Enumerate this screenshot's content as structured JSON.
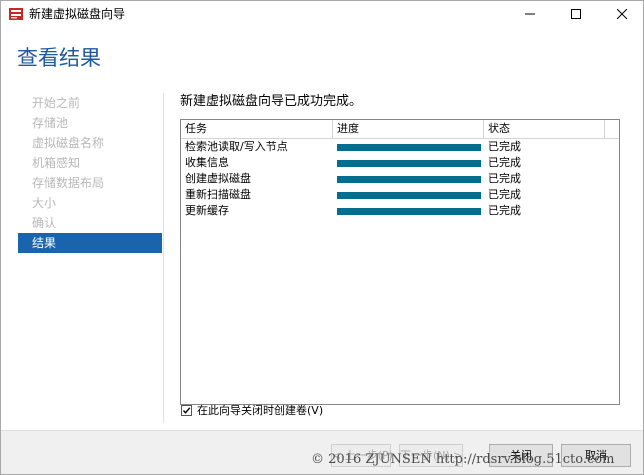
{
  "window": {
    "title": "新建虚拟磁盘向导",
    "controls": [
      "minimize-icon",
      "maximize-icon",
      "close-icon"
    ]
  },
  "page_heading": "查看结果",
  "nav": {
    "items": [
      {
        "label": "开始之前",
        "active": false
      },
      {
        "label": "存储池",
        "active": false
      },
      {
        "label": "虚拟磁盘名称",
        "active": false
      },
      {
        "label": "机箱感知",
        "active": false
      },
      {
        "label": "存储数据布局",
        "active": false
      },
      {
        "label": "大小",
        "active": false
      },
      {
        "label": "确认",
        "active": false
      },
      {
        "label": "结果",
        "active": true
      }
    ]
  },
  "main": {
    "result_title": "新建虚拟磁盘向导已成功完成。",
    "table": {
      "columns": [
        "任务",
        "进度",
        "状态"
      ],
      "rows": [
        {
          "task": "检索池读取/写入节点",
          "progress": 1.0,
          "status": "已完成"
        },
        {
          "task": "收集信息",
          "progress": 1.0,
          "status": "已完成"
        },
        {
          "task": "创建虚拟磁盘",
          "progress": 1.0,
          "status": "已完成"
        },
        {
          "task": "重新扫描磁盘",
          "progress": 1.0,
          "status": "已完成"
        },
        {
          "task": "更新缓存",
          "progress": 1.0,
          "status": "已完成"
        }
      ]
    },
    "checkbox": {
      "label": "在此向导关闭时创建卷(V)",
      "checked": true
    }
  },
  "buttons": {
    "prev": "< 上一步(P)",
    "next": "下一步(N) >",
    "close": "关闭",
    "cancel": "取消"
  },
  "watermark": "© 2016 ZJUNSEN http://rdsrv.blog.51cto.com",
  "colors": {
    "accent": "#1a64ad",
    "heading": "#1f5a9c",
    "progress_fill": "#006e8c"
  }
}
